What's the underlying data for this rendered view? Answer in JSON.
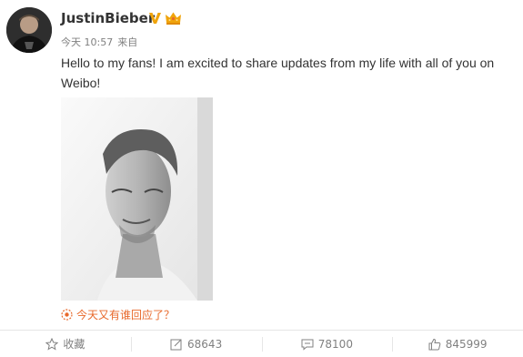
{
  "post": {
    "author": {
      "name": "JustinBieber",
      "avatar_icon": "avatar-photo",
      "badges": [
        "verified-v-icon",
        "crown-icon"
      ]
    },
    "meta": {
      "time": "今天 10:57",
      "source": "来自"
    },
    "text": "Hello to my fans! I am excited to share updates from my life with all of you on Weibo!",
    "image_icon": "portrait-photo",
    "topic": {
      "icon": "topic-star-icon",
      "label": "今天又有谁回应了？",
      "color": "#e8692b"
    }
  },
  "actions": {
    "favorite": {
      "icon": "star-icon",
      "label": "收藏"
    },
    "repost": {
      "icon": "repost-icon",
      "count": "68643"
    },
    "comment": {
      "icon": "comment-icon",
      "count": "78100"
    },
    "like": {
      "icon": "thumbs-up-icon",
      "count": "845999"
    }
  },
  "colors": {
    "text": "#333333",
    "meta": "#808080",
    "badge_gold": "#f0a40c",
    "accent_orange": "#e8692b",
    "divider": "#e6e6e6"
  }
}
